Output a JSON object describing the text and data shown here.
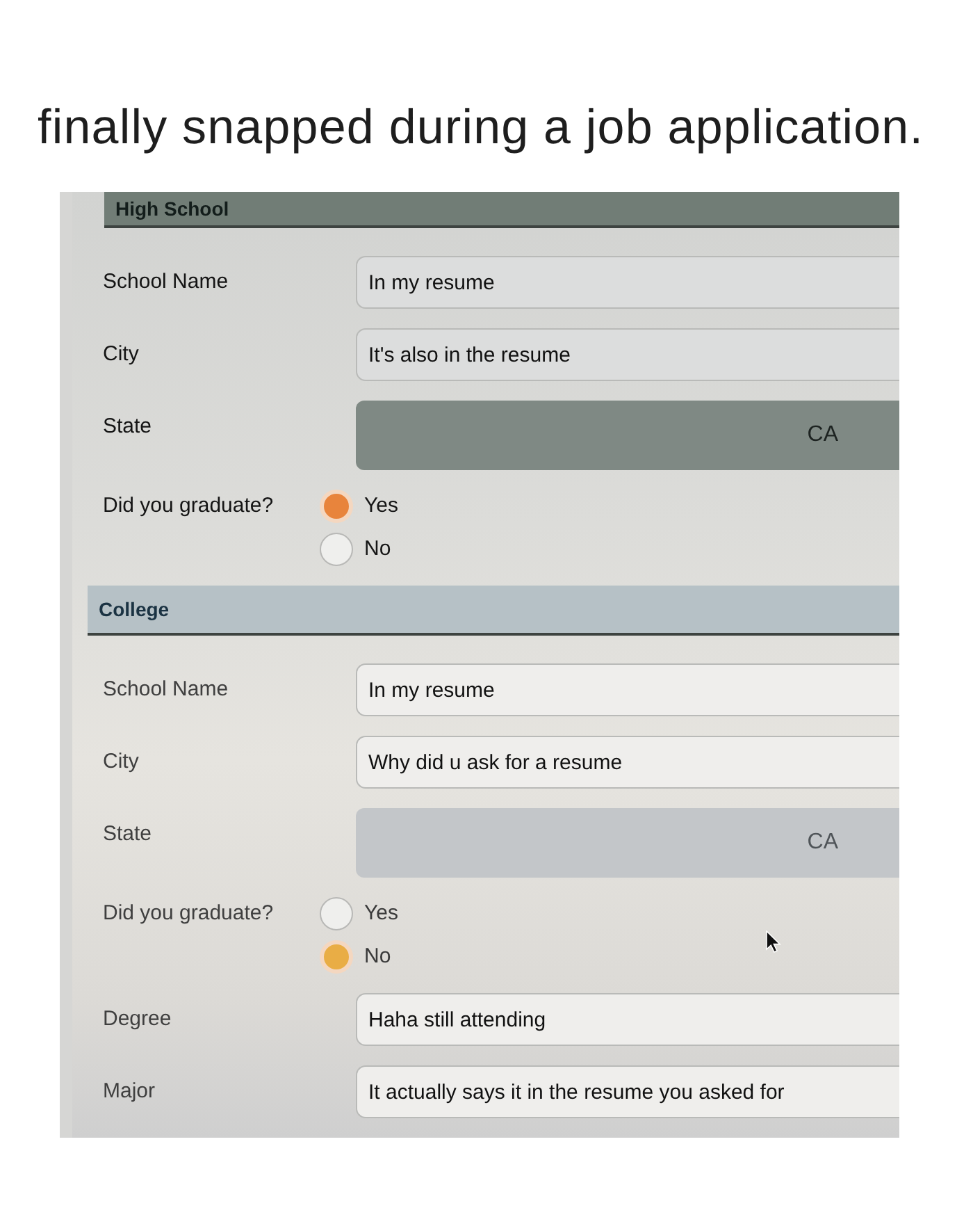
{
  "caption": "finally snapped during a job application.",
  "sections": [
    {
      "title": "High School",
      "fields": [
        {
          "kind": "text",
          "label": "School Name",
          "value": "In my resume"
        },
        {
          "kind": "text",
          "label": "City",
          "value": "It's also in the resume"
        },
        {
          "kind": "select",
          "label": "State",
          "value": "CA"
        },
        {
          "kind": "radio",
          "label": "Did you graduate?",
          "options": [
            {
              "label": "Yes",
              "selected": true
            },
            {
              "label": "No",
              "selected": false
            }
          ]
        }
      ]
    },
    {
      "title": "College",
      "fields": [
        {
          "kind": "text",
          "label": "School Name",
          "value": "In my resume"
        },
        {
          "kind": "text",
          "label": "City",
          "value": "Why did u ask for a resume"
        },
        {
          "kind": "select",
          "label": "State",
          "value": "CA"
        },
        {
          "kind": "radio",
          "label": "Did you graduate?",
          "options": [
            {
              "label": "Yes",
              "selected": false
            },
            {
              "label": "No",
              "selected": true
            }
          ]
        },
        {
          "kind": "text",
          "label": "Degree",
          "value": "Haha still attending"
        },
        {
          "kind": "text",
          "label": "Major",
          "value": "It actually says it in the resume you asked for"
        }
      ]
    }
  ]
}
